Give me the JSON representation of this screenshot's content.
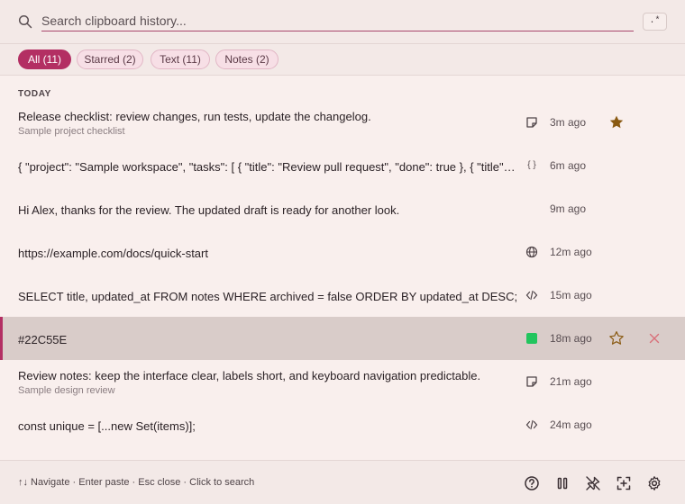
{
  "search": {
    "placeholder": "Search clipboard history...",
    "value": "",
    "regex_label": ".*"
  },
  "filters": [
    {
      "label": "All (11)",
      "active": true
    },
    {
      "label": "Starred (2)",
      "active": false
    },
    {
      "label": "Text (11)",
      "active": false
    },
    {
      "label": "Notes (2)",
      "active": false
    }
  ],
  "section": {
    "label": "TODAY"
  },
  "items": [
    {
      "title": "Release checklist: review changes, run tests, update the changelog.",
      "subtitle": "Sample project checklist",
      "type_icon": "note-icon",
      "time": "3m ago",
      "starred": true
    },
    {
      "title": "{ \"project\": \"Sample workspace\", \"tasks\": [ { \"title\": \"Review pull request\", \"done\": true }, { \"title\": \"Update docs\" } ] }",
      "subtitle": "",
      "type_icon": "json-icon",
      "type_glyph": "{ }",
      "time": "6m ago",
      "starred": false
    },
    {
      "title": "Hi Alex, thanks for the review. The updated draft is ready for another look.",
      "subtitle": "",
      "type_icon": "",
      "time": "9m ago",
      "starred": false
    },
    {
      "title": "https://example.com/docs/quick-start",
      "subtitle": "",
      "type_icon": "globe-icon",
      "time": "12m ago",
      "starred": false
    },
    {
      "title": "SELECT title, updated_at FROM notes WHERE archived = false ORDER BY updated_at DESC;",
      "subtitle": "",
      "type_icon": "code-icon",
      "time": "15m ago",
      "starred": false
    },
    {
      "title": "#22C55E",
      "subtitle": "",
      "type_icon": "color-swatch",
      "swatch_color": "#22C55E",
      "time": "18m ago",
      "starred": false,
      "selected": true
    },
    {
      "title": "Review notes: keep the interface clear, labels short, and keyboard navigation predictable.",
      "subtitle": "Sample design review",
      "type_icon": "note-icon",
      "time": "21m ago",
      "starred": false
    },
    {
      "title": "const unique = [...new Set(items)];",
      "subtitle": "",
      "type_icon": "code-icon",
      "time": "24m ago",
      "starred": false
    }
  ],
  "footer": {
    "hint": "↑↓ Navigate · Enter paste · Esc close · Click to search",
    "buttons": [
      "help-icon",
      "pause-icon",
      "pin-off-icon",
      "capture-icon",
      "settings-icon"
    ]
  },
  "colors": {
    "accent": "#b32f63",
    "star": "#8a5a12",
    "delete": "#d9707a",
    "background": "#f9efed"
  }
}
